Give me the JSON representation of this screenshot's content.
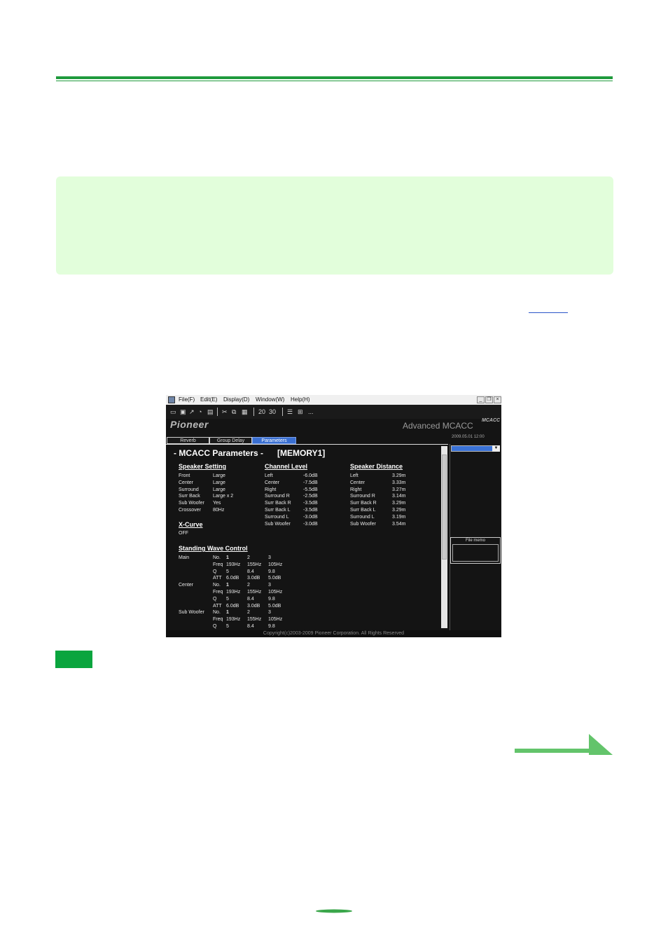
{
  "window": {
    "menu": [
      "File(F)",
      "Edit(E)",
      "Display(D)",
      "Window(W)",
      "Help(H)"
    ],
    "toolbar": {
      "num1": "20",
      "num2": "30",
      "more": "..."
    },
    "brand": "Pioneer",
    "product": "Advanced MCACC",
    "badge": "MCACC",
    "datetime": "2009.05.01 12:00",
    "tabs": [
      "Reverb",
      "Group Delay",
      "Parameters"
    ],
    "active_tab": "Parameters",
    "params_title": "- MCACC Parameters -      [MEMORY1]",
    "speaker_setting": {
      "title": "Speaker Setting",
      "rows": [
        [
          "Front",
          "Large"
        ],
        [
          "Center",
          "Large"
        ],
        [
          "Surround",
          "Large"
        ],
        [
          "Surr Back",
          "Large x 2"
        ],
        [
          "Sub Woofer",
          "Yes"
        ],
        [
          "Crossover",
          "80Hz"
        ]
      ]
    },
    "channel_level": {
      "title": "Channel Level",
      "rows": [
        [
          "Left",
          "-6.0dB"
        ],
        [
          "Center",
          "-7.5dB"
        ],
        [
          "Right",
          "-5.5dB"
        ],
        [
          "Surround R",
          "-2.5dB"
        ],
        [
          "Surr Back R",
          "-3.5dB"
        ],
        [
          "Surr Back L",
          "-3.5dB"
        ],
        [
          "Surround L",
          "-3.0dB"
        ],
        [
          "Sub Woofer",
          "-3.0dB"
        ]
      ]
    },
    "speaker_distance": {
      "title": "Speaker Distance",
      "rows": [
        [
          "Left",
          "3.29m"
        ],
        [
          "Center",
          "3.33m"
        ],
        [
          "Right",
          "3.27m"
        ],
        [
          "Surround R",
          "3.14m"
        ],
        [
          "Surr Back R",
          "3.29m"
        ],
        [
          "Surr Back L",
          "3.29m"
        ],
        [
          "Surround L",
          "3.19m"
        ],
        [
          "Sub Woofer",
          "3.54m"
        ]
      ]
    },
    "xcurve": {
      "title": "X-Curve",
      "value": "OFF"
    },
    "standing_wave": {
      "title": "Standing Wave Control",
      "groups": [
        {
          "name": "Main",
          "rows": [
            [
              "No.",
              "1",
              "2",
              "3"
            ],
            [
              "Freq",
              "193Hz",
              "155Hz",
              "105Hz"
            ],
            [
              "Q",
              "5",
              "8.4",
              "9.8"
            ],
            [
              "ATT",
              "6.0dB",
              "3.0dB",
              "5.0dB"
            ]
          ]
        },
        {
          "name": "Center",
          "rows": [
            [
              "No.",
              "1",
              "2",
              "3"
            ],
            [
              "Freq",
              "193Hz",
              "155Hz",
              "105Hz"
            ],
            [
              "Q",
              "5",
              "8.4",
              "9.8"
            ],
            [
              "ATT",
              "6.0dB",
              "3.0dB",
              "5.0dB"
            ]
          ]
        },
        {
          "name": "Sub Woofer",
          "rows": [
            [
              "No.",
              "1",
              "2",
              "3"
            ],
            [
              "Freq",
              "193Hz",
              "155Hz",
              "105Hz"
            ],
            [
              "Q",
              "5",
              "8.4",
              "9.8"
            ]
          ]
        }
      ]
    },
    "file_memo": "File memo",
    "copyright": "Copyright(c)2003-2009 Pioneer Corporation. All Rights Reserved"
  }
}
